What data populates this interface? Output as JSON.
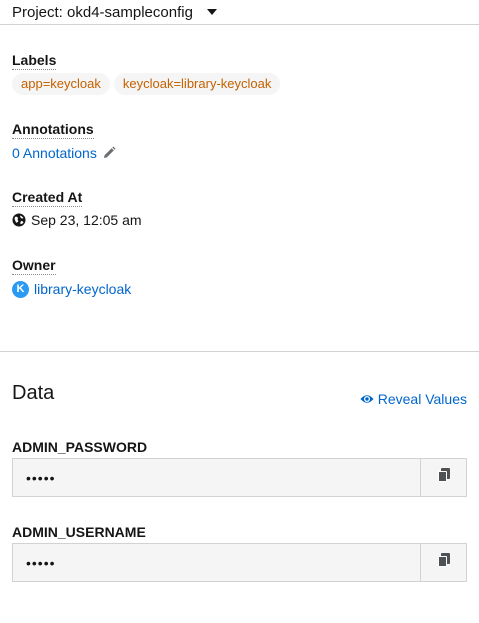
{
  "project": {
    "label": "Project: okd4-sampleconfig"
  },
  "labels": {
    "title": "Labels",
    "items": [
      "app=keycloak",
      "keycloak=library-keycloak"
    ]
  },
  "annotations": {
    "title": "Annotations",
    "link": "0 Annotations"
  },
  "created": {
    "title": "Created At",
    "value": "Sep 23, 12:05 am"
  },
  "owner": {
    "title": "Owner",
    "badge": "K",
    "name": "library-keycloak"
  },
  "data_section": {
    "title": "Data",
    "reveal_label": "Reveal Values",
    "secrets": [
      {
        "key": "ADMIN_PASSWORD",
        "masked": "•••••"
      },
      {
        "key": "ADMIN_USERNAME",
        "masked": "•••••"
      }
    ]
  },
  "colors": {
    "link": "#0066cc",
    "label_text": "#c46100",
    "owner_badge": "#2b9af3"
  },
  "icons": [
    "chevron-down-icon",
    "pencil-icon",
    "globe-icon",
    "eye-icon",
    "copy-icon"
  ]
}
